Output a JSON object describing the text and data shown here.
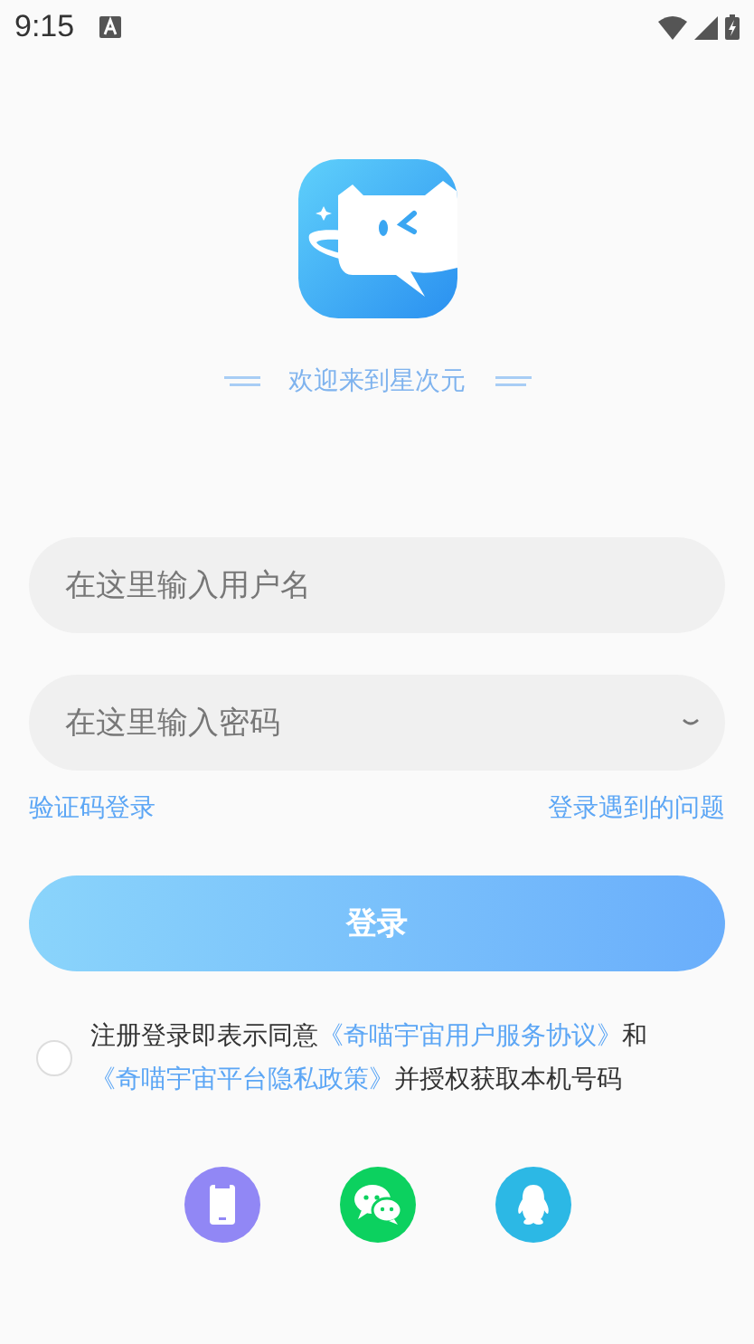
{
  "status_bar": {
    "time": "9:15"
  },
  "welcome": "欢迎来到星次元",
  "username": {
    "placeholder": "在这里输入用户名"
  },
  "password": {
    "placeholder": "在这里输入密码"
  },
  "links": [
    "验证码登录",
    "登录遇到的问题"
  ],
  "login_button": "登录",
  "agreement": {
    "checked": false,
    "parts": [
      {
        "kind": "text",
        "text": "注册登录即表示同意"
      },
      {
        "kind": "link",
        "text": "《奇喵宇宙用户服务协议》"
      },
      {
        "kind": "text",
        "text": "和"
      },
      {
        "kind": "link",
        "text": "《奇喵宇宙平台隐私政策》"
      },
      {
        "kind": "text",
        "text": "并授权获取本机号码"
      }
    ]
  },
  "social": [
    {
      "kind": "phone"
    },
    {
      "kind": "wechat"
    },
    {
      "kind": "qq"
    }
  ]
}
